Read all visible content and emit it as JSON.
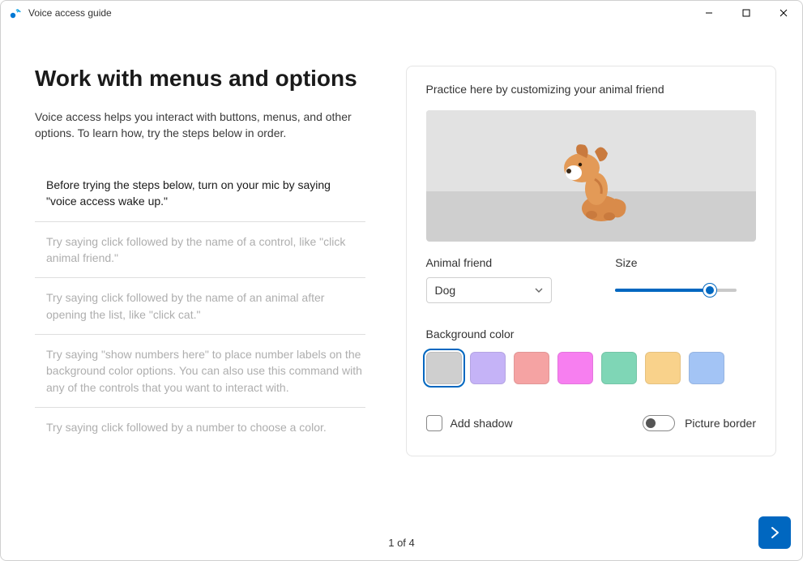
{
  "window": {
    "title": "Voice access guide"
  },
  "left": {
    "heading": "Work with menus and options",
    "intro": "Voice access helps you interact with buttons, menus, and other options. To learn how, try the steps below in order.",
    "steps": [
      "Before trying the steps below, turn on your mic by saying \"voice access wake up.\"",
      "Try saying click followed by the name of a control, like \"click animal friend.\"",
      "Try saying click followed by the name of an animal after opening the list, like \"click cat.\"",
      "Try saying \"show numbers here\" to place number labels on the background color options. You can also use this command with any of the controls that you want to interact with.",
      "Try saying click followed by a number to choose a color."
    ]
  },
  "right": {
    "practice_label": "Practice here by customizing your animal friend",
    "animal_label": "Animal friend",
    "animal_value": "Dog",
    "size_label": "Size",
    "bgcolor_label": "Background color",
    "colors": [
      "#cfcfcf",
      "#c5b3f7",
      "#f5a3a3",
      "#f77ff0",
      "#7fd6b6",
      "#f9d28b",
      "#a3c4f5"
    ],
    "selected_color_index": 0,
    "add_shadow_label": "Add shadow",
    "picture_border_label": "Picture border"
  },
  "footer": {
    "page_indicator": "1 of 4"
  }
}
